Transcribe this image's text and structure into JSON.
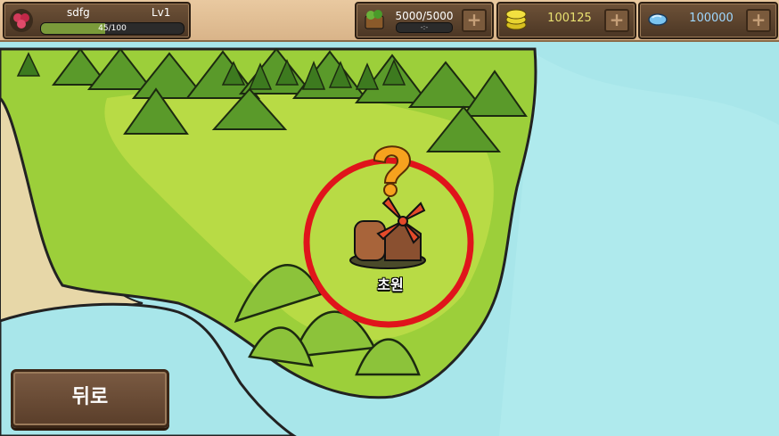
{
  "player": {
    "name": "sdfg",
    "level": "Lv1",
    "xp_text": "45/100",
    "xp_fraction": 0.45
  },
  "resources": {
    "stamina": {
      "icon": "wood-basket-icon",
      "value": "5000/5000",
      "timer": "-:-"
    },
    "gold": {
      "icon": "gold-coins-icon",
      "value": "100125"
    },
    "gem": {
      "icon": "blue-gem-icon",
      "value": "100000"
    }
  },
  "map": {
    "location": {
      "name": "초원",
      "icon": "windmill-icon",
      "quest_marker": "question-mark-icon"
    }
  },
  "back_button": {
    "label": "뒤로"
  },
  "colors": {
    "sea": "#a8e6ea",
    "grass": "#9ccf3a",
    "highlight_ring": "#e0141b",
    "panel": "#5a3f29"
  }
}
